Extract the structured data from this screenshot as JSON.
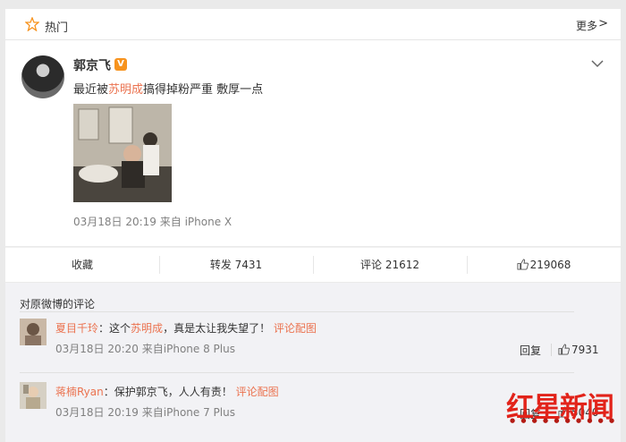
{
  "header": {
    "hot_label": "热门",
    "more_label": "更多",
    "more_chevron": ">",
    "icons": {
      "hot": "star-outline-icon"
    },
    "colors": {
      "star": "#f7931e"
    }
  },
  "post": {
    "username": "郭京飞",
    "verified_badge": "V",
    "text_before": "最近被",
    "mention": "苏明成",
    "text_after": "搞得掉粉严重 敷厚一点",
    "timestamp": "03月18日 20:19",
    "source": "来自 iPhone X"
  },
  "actions": {
    "collect": "收藏",
    "repost": "转发 7431",
    "comment": "评论 21612",
    "like": "219068"
  },
  "comments": {
    "title": "对原微博的评论",
    "items": [
      {
        "user": "夏目千玲",
        "colon": "：",
        "text_before": "这个",
        "mention": "苏明成",
        "text_after": "，真是太让我失望了！",
        "link": "评论配图",
        "timestamp": "03月18日 20:20",
        "source": "来自iPhone 8 Plus",
        "reply": "回复",
        "likes": "7931"
      },
      {
        "user": "蒋楠Ryan",
        "colon": "：",
        "text": "保护郭京飞，人人有责！",
        "link": "评论配图",
        "timestamp": "03月18日 20:19",
        "source": "来自iPhone 7 Plus",
        "reply": "回复",
        "likes": "5040"
      }
    ]
  },
  "watermark": {
    "text": "红星新闻",
    "color": "#e2231a"
  },
  "colors": {
    "accent": "#eb7350",
    "meta": "#808080",
    "background": "#eaeaea"
  }
}
